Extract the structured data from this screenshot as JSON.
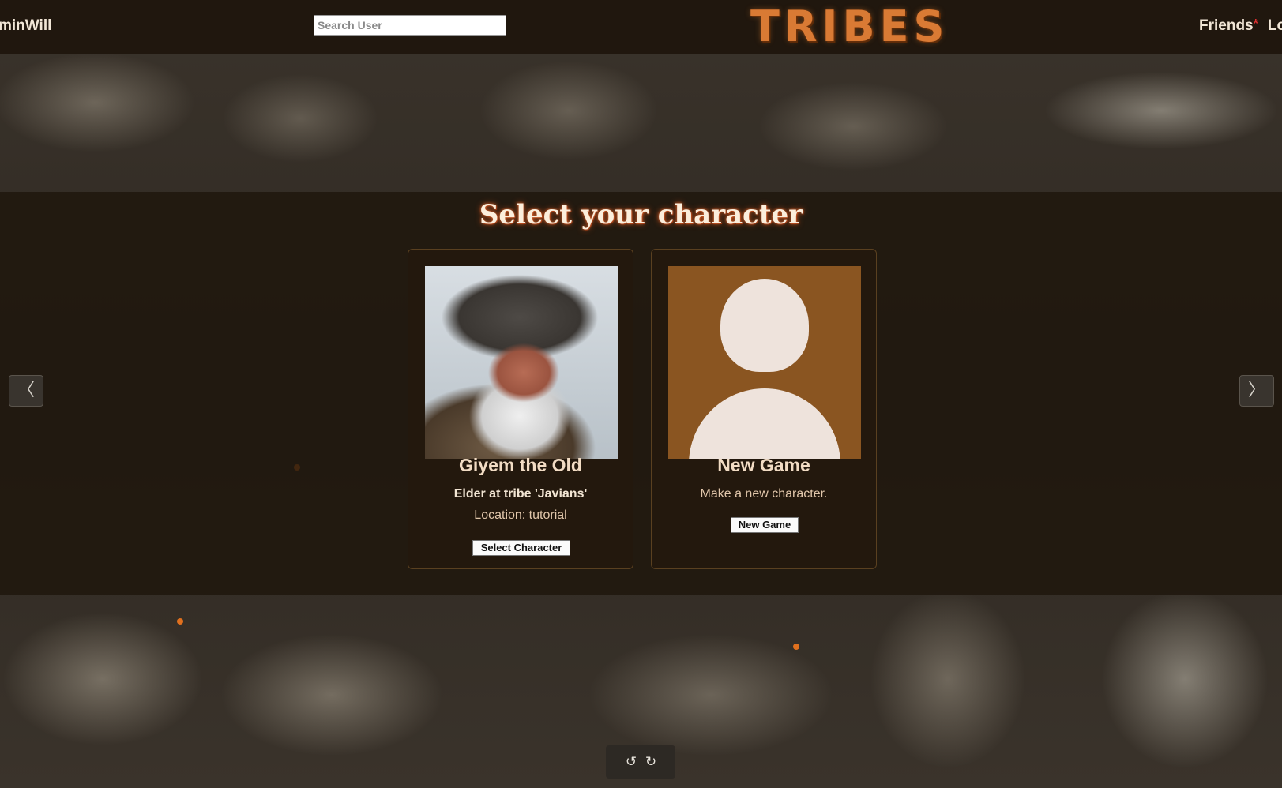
{
  "header": {
    "user_name": "minWill",
    "search_placeholder": "Search User",
    "logo_text": "TRIBES",
    "nav": {
      "friends_label": "Friends",
      "friends_badge": "*",
      "next_label": "Lo"
    }
  },
  "main": {
    "title": "Select your character",
    "cards": [
      {
        "name": "Giyem the Old",
        "role": "Elder at tribe 'Javians'",
        "location": "Location: tutorial",
        "button_label": "Select Character"
      },
      {
        "name": "New Game",
        "description": "Make a new character.",
        "button_label": "New Game"
      }
    ],
    "prev_label": "〈",
    "next_label": "〉"
  },
  "toolbar": {
    "undo_icon": "↺",
    "redo_icon": "↻"
  },
  "colors": {
    "accent": "#d97a34",
    "card_title": "#f2dcc4",
    "placeholder_bg": "#8a5521"
  }
}
